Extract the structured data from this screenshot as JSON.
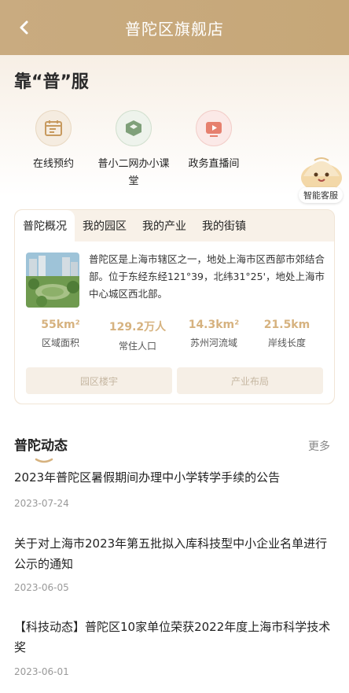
{
  "header": {
    "title": "普陀区旗舰店",
    "back_icon": "chevron-left-icon"
  },
  "section": {
    "title": "靠“普”服"
  },
  "services": [
    {
      "label": "在线预约",
      "icon": "calendar-icon"
    },
    {
      "label": "普小二网办小课堂",
      "icon": "classroom-icon"
    },
    {
      "label": "政务直播间",
      "icon": "video-play-icon"
    }
  ],
  "assistant": {
    "label": "智能客服"
  },
  "tabs": [
    "普陀概况",
    "我的园区",
    "我的产业",
    "我的街镇"
  ],
  "overview": {
    "description": "普陀区是上海市辖区之一，地处上海市区西部市郊结合部。位于东经东经121°39，北纬31°25'，地处上海市中心城区西北部。",
    "stats": [
      {
        "value": "55km²",
        "label": "区域面积"
      },
      {
        "value": "129.2万人",
        "label": "常住人口"
      },
      {
        "value": "14.3km²",
        "label": "苏州河流域"
      },
      {
        "value": "21.5km",
        "label": "岸线长度"
      }
    ],
    "buttons": [
      "园区楼宇",
      "产业布局"
    ]
  },
  "news": {
    "title": "普陀动态",
    "more": "更多",
    "items": [
      {
        "title": "2023年普陀区暑假期间办理中小学转学手续的公告",
        "date": "2023-07-24"
      },
      {
        "title": "关于对上海市2023年第五批拟入库科技型中小企业名单进行公示的通知",
        "date": "2023-06-05"
      },
      {
        "title": "【科技动态】普陀区10家单位荣获2022年度上海市科学技术奖",
        "date": "2023-06-01"
      }
    ]
  },
  "colors": {
    "brand": "#c9ab80",
    "accent": "#d6b27f"
  }
}
